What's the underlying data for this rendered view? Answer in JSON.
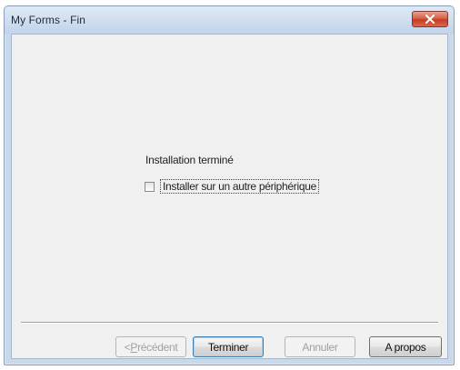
{
  "window": {
    "title": "My Forms - Fin"
  },
  "content": {
    "message": "Installation terminé",
    "checkbox_label": "Installer sur un autre périphérique",
    "checkbox_checked": false
  },
  "buttons": {
    "previous_prefix": "< ",
    "previous_mnemonic": "P",
    "previous_rest": "récédent",
    "finish": "Terminer",
    "cancel": "Annuler",
    "about": "A propos"
  },
  "colors": {
    "close_button": "#c43d21",
    "dialog_background": "#f0f0f0"
  }
}
